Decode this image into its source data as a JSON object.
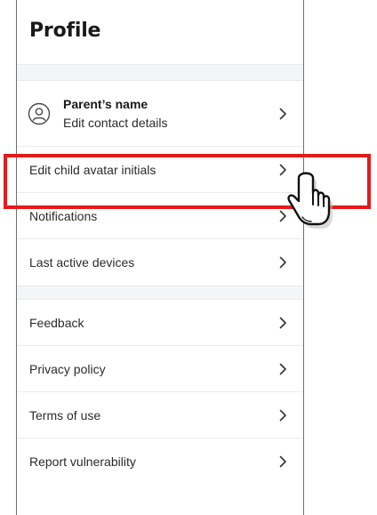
{
  "page": {
    "title": "Profile"
  },
  "profile": {
    "name": "Parent’s name",
    "subtitle": "Edit contact details",
    "icon": "user-circle-icon"
  },
  "menu_group_1": [
    {
      "id": "edit-child-avatar-initials",
      "label": "Edit child avatar initials"
    },
    {
      "id": "notifications",
      "label": "Notifications"
    },
    {
      "id": "last-active-devices",
      "label": "Last active devices"
    }
  ],
  "menu_group_2": [
    {
      "id": "feedback",
      "label": "Feedback"
    },
    {
      "id": "privacy-policy",
      "label": "Privacy policy"
    },
    {
      "id": "terms-of-use",
      "label": "Terms of use"
    },
    {
      "id": "report-vulnerability",
      "label": "Report vulnerability"
    }
  ],
  "annotations": {
    "highlight_color": "#e31b1b",
    "pointer_icon": "pointing-hand-icon"
  }
}
